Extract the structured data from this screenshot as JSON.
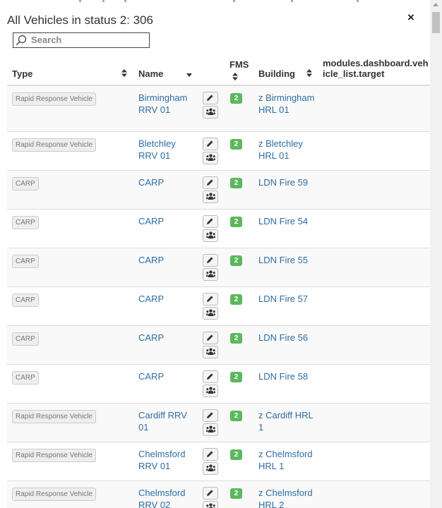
{
  "modal": {
    "title": "All Vehicles in status 2: 306",
    "close_label": "×"
  },
  "search": {
    "placeholder": "Search"
  },
  "columns": {
    "type": "Type",
    "name": "Name",
    "fms": "FMS",
    "building": "Building",
    "target": "modules.dashboard.vehicle_list.target"
  },
  "rows": [
    {
      "type": "Rapid Response Vehicle",
      "name": "Birmingham RRV 01",
      "fms": "2",
      "building": "z Birmingham HRL 01"
    },
    {
      "type": "Rapid Response Vehicle",
      "name": "Bletchley RRV 01",
      "fms": "2",
      "building": "z Bletchley HRL 01"
    },
    {
      "type": "CARP",
      "name": "CARP",
      "fms": "2",
      "building": "LDN Fire 59"
    },
    {
      "type": "CARP",
      "name": "CARP",
      "fms": "2",
      "building": "LDN Fire 54"
    },
    {
      "type": "CARP",
      "name": "CARP",
      "fms": "2",
      "building": "LDN Fire 55"
    },
    {
      "type": "CARP",
      "name": "CARP",
      "fms": "2",
      "building": "LDN Fire 57"
    },
    {
      "type": "CARP",
      "name": "CARP",
      "fms": "2",
      "building": "LDN Fire 56"
    },
    {
      "type": "CARP",
      "name": "CARP",
      "fms": "2",
      "building": "LDN Fire 58"
    },
    {
      "type": "Rapid Response Vehicle",
      "name": "Cardiff RRV 01",
      "fms": "2",
      "building": "z Cardiff HRL 1"
    },
    {
      "type": "Rapid Response Vehicle",
      "name": "Chelmsford RRV 01",
      "fms": "2",
      "building": "z Chelmsford HRL 1"
    },
    {
      "type": "Rapid Response Vehicle",
      "name": "Chelmsford RRV 02",
      "fms": "2",
      "building": "z Chelmsford HRL 2"
    }
  ],
  "colors": {
    "link": "#2e6da4",
    "fms_status": "#5cb85c",
    "row_stripe": "#f9f9f9"
  },
  "icons": {
    "search": "search-icon",
    "edit": "pencil-icon",
    "crew": "users-icon",
    "sort": "sort-icon"
  }
}
